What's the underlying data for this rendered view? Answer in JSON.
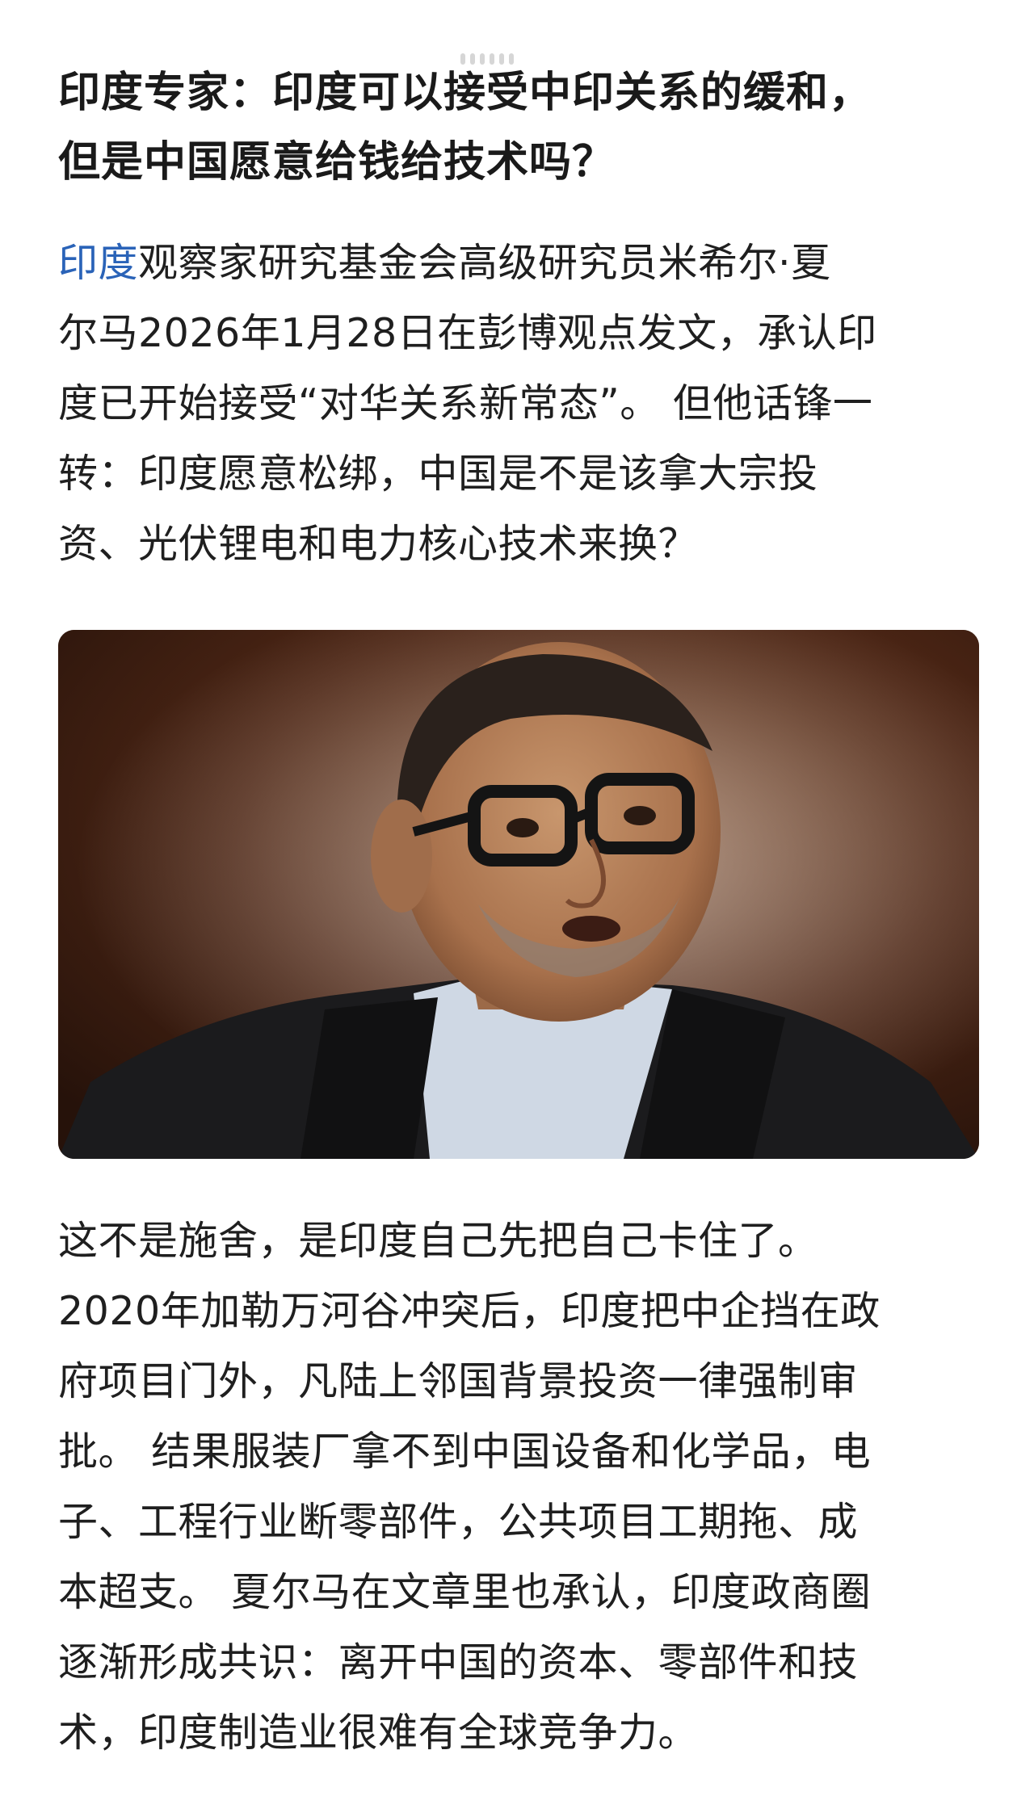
{
  "article": {
    "title_lines": [
      "印度专家：印度可以接受中印关系的缓和，",
      "但是中国愿意给钱给技术吗？"
    ],
    "para1": {
      "link": "印度",
      "line1_rest": "观察家研究基金会高级研究员米希尔·夏",
      "lines": [
        "尔马2026年1月28日在彭博观点发文，承认印",
        "度已开始接受“对华关系新常态”。 但他话锋一",
        "转：印度愿意松绑，中国是不是该拿大宗投",
        "资、光伏锂电和电力核心技术来换？"
      ]
    },
    "para2": {
      "lines": [
        "这不是施舍，是印度自己先把自己卡住了。",
        "2020年加勒万河谷冲突后，印度把中企挡在政",
        "府项目门外，凡陆上邻国背景投资一律强制审",
        "批。 结果服装厂拿不到中国设备和化学品，电",
        "子、工程行业断零部件，公共项目工期拖、成",
        "本超支。 夏尔马在文章里也承认，印度政商圈",
        "逐渐形成共识：离开中国的资本、零部件和技",
        "术，印度制造业很难有全球竞争力。"
      ]
    }
  },
  "colors": {
    "link": "#2a63b8",
    "text": "#1f1f1f",
    "background": "#ffffff"
  },
  "image": {
    "subject": "portrait-photo"
  }
}
